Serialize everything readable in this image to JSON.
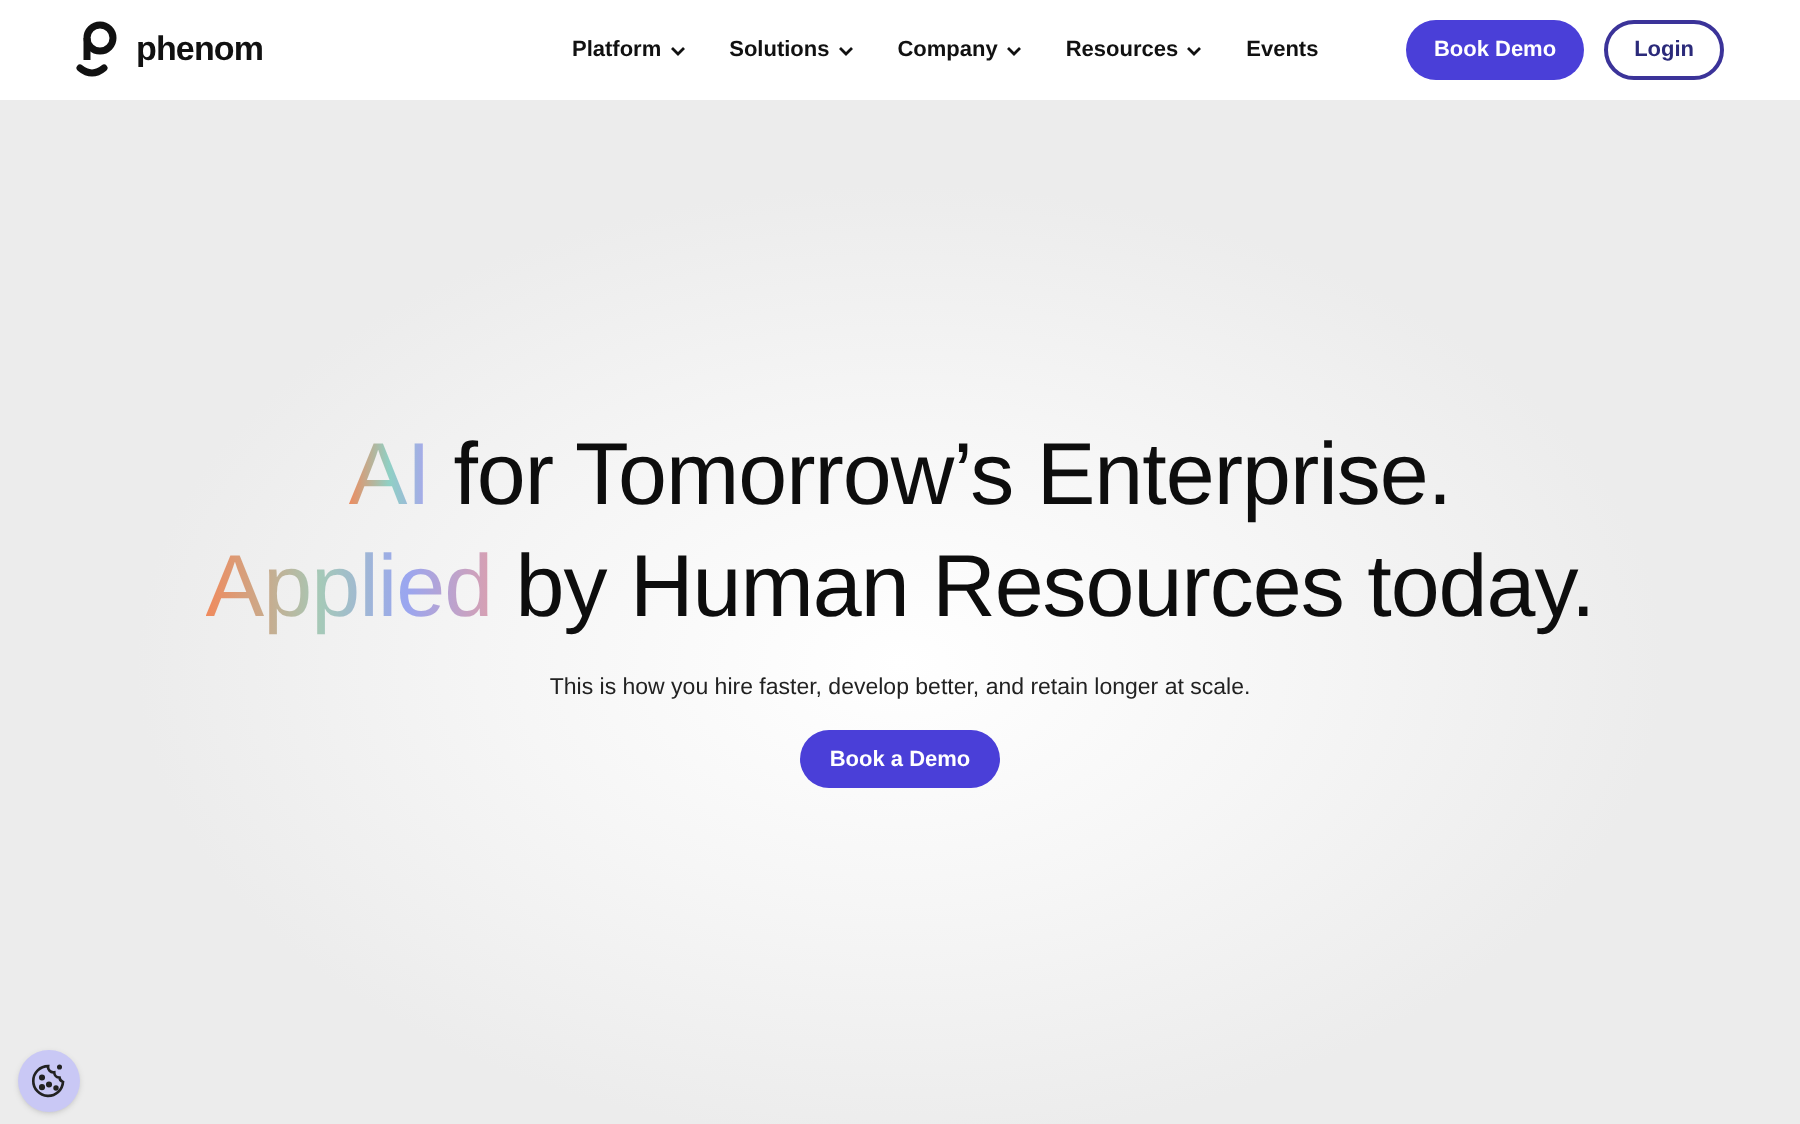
{
  "logo": {
    "wordmark": "phenom"
  },
  "nav": [
    {
      "label": "Platform",
      "dropdown": true
    },
    {
      "label": "Solutions",
      "dropdown": true
    },
    {
      "label": "Company",
      "dropdown": true
    },
    {
      "label": "Resources",
      "dropdown": true
    },
    {
      "label": "Events",
      "dropdown": false
    }
  ],
  "actions": {
    "primary": "Book Demo",
    "secondary": "Login"
  },
  "hero": {
    "headline": [
      {
        "highlight": "AI",
        "rest": "for Tomorrow’s Enterprise."
      },
      {
        "highlight": "Applied",
        "rest": "by Human Resources today."
      }
    ],
    "subtitle": "This is how you hire faster, develop better, and retain longer at scale.",
    "cta": "Book a Demo"
  }
}
